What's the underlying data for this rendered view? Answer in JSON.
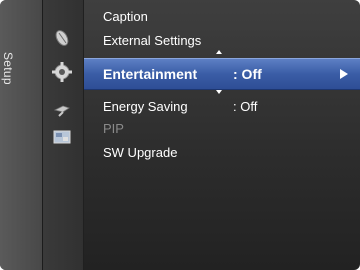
{
  "sidebar": {
    "tab_label": "Setup",
    "icons": [
      "satellite-dish-icon",
      "setup-gear-icon",
      "input-plug-icon",
      "application-icon"
    ]
  },
  "menu": {
    "items": [
      {
        "label": "Caption",
        "value": ""
      },
      {
        "label": "External Settings",
        "value": ""
      },
      {
        "label": "Entertainment",
        "value": ": Off",
        "selected": true
      },
      {
        "label": "Energy Saving",
        "value": ": Off"
      },
      {
        "label": "PIP",
        "value": "",
        "disabled": true
      },
      {
        "label": "SW Upgrade",
        "value": ""
      }
    ]
  },
  "colors": {
    "highlight": "#3a5da6",
    "background": "#2c2c2c",
    "disabled_text": "#8a8a8a"
  }
}
